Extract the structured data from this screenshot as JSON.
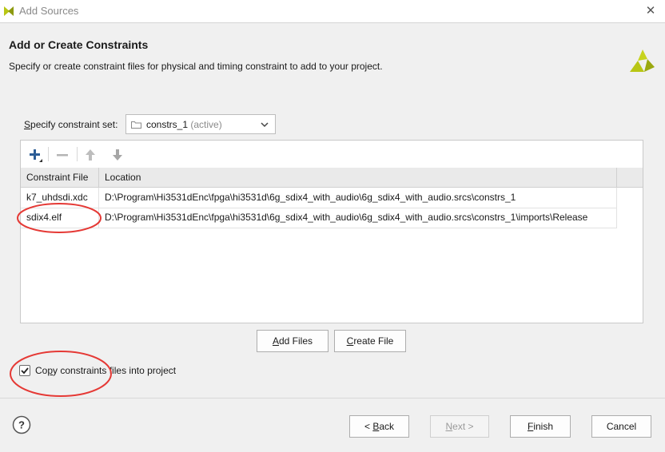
{
  "window": {
    "title": "Add Sources",
    "close_glyph": "✕"
  },
  "header": {
    "title": "Add or Create Constraints",
    "description": "Specify or create constraint files for physical and timing constraint to add to your project."
  },
  "constraint_set": {
    "label_prefix": "S",
    "label_rest": "pecify constraint set:",
    "selected_name": "constrs_1",
    "selected_status": "(active)"
  },
  "table": {
    "columns": [
      "Constraint File",
      "Location"
    ],
    "rows": [
      {
        "file": "k7_uhdsdi.xdc",
        "location": "D:\\Program\\Hi3531dEnc\\fpga\\hi3531d\\6g_sdix4_with_audio\\6g_sdix4_with_audio.srcs\\constrs_1"
      },
      {
        "file": "sdix4.elf",
        "location": "D:\\Program\\Hi3531dEnc\\fpga\\hi3531d\\6g_sdix4_with_audio\\6g_sdix4_with_audio.srcs\\constrs_1\\imports\\Release"
      }
    ]
  },
  "actions": {
    "add_files_u": "A",
    "add_files_rest": "dd Files",
    "create_file_u": "C",
    "create_file_rest": "reate File"
  },
  "copy_option": {
    "checked": true,
    "label_prefix": "Co",
    "label_u": "p",
    "label_rest": "y constraints files into project"
  },
  "footer": {
    "back_prefix": "< ",
    "back_u": "B",
    "back_rest": "ack",
    "next_u": "N",
    "next_rest": "ext >",
    "finish_u": "F",
    "finish_rest": "inish",
    "cancel": "Cancel"
  },
  "colors": {
    "brand_yellow": "#b8c614",
    "accent_blue": "#2c5d96",
    "annotation_red": "#e53935"
  }
}
